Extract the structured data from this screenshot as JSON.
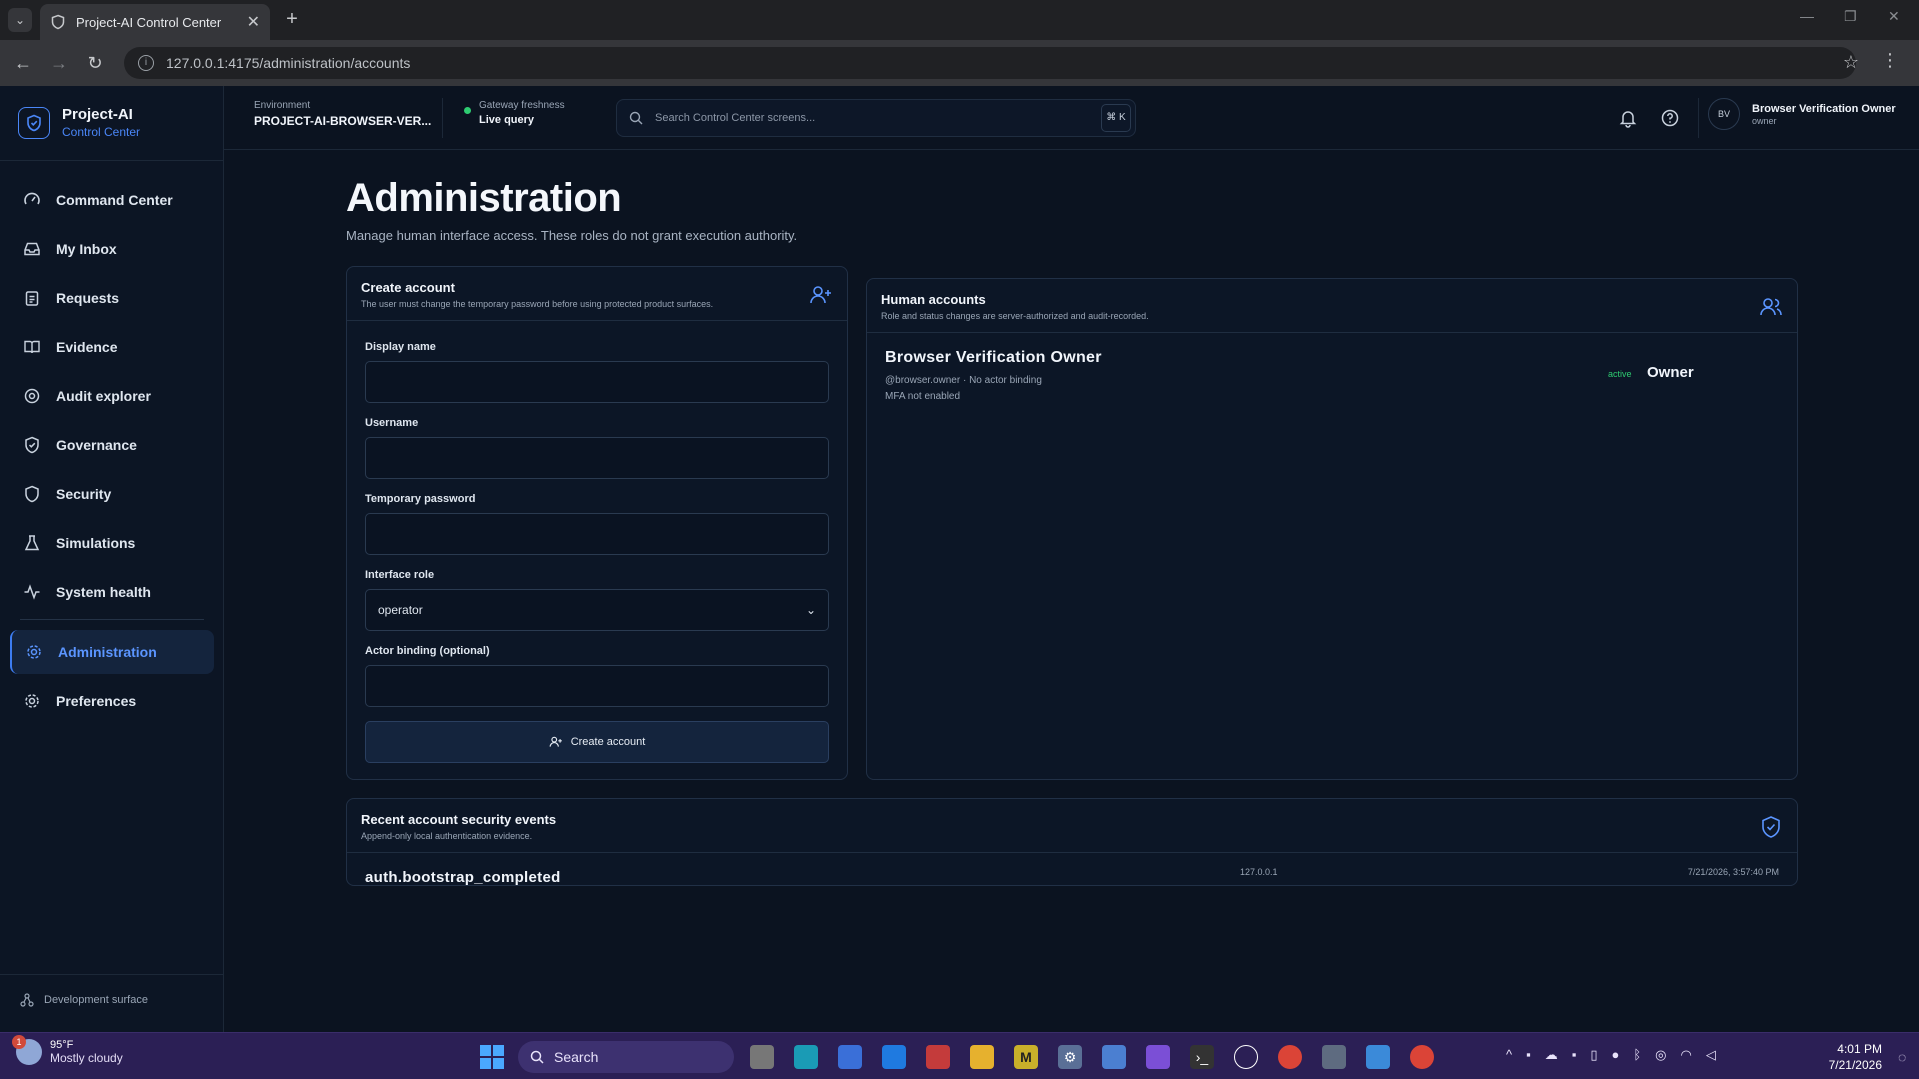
{
  "browser": {
    "tab_title": "Project-AI Control Center",
    "url": "127.0.0.1:4175/administration/accounts"
  },
  "brand": {
    "name": "Project-AI",
    "subtitle": "Control Center"
  },
  "sidebar": {
    "items": [
      {
        "label": "Command Center",
        "icon": "gauge-icon"
      },
      {
        "label": "My Inbox",
        "icon": "inbox-icon"
      },
      {
        "label": "Requests",
        "icon": "clipboard-icon"
      },
      {
        "label": "Evidence",
        "icon": "book-icon"
      },
      {
        "label": "Audit explorer",
        "icon": "audit-icon"
      },
      {
        "label": "Governance",
        "icon": "shield-check-icon"
      },
      {
        "label": "Security",
        "icon": "shield-icon"
      },
      {
        "label": "Simulations",
        "icon": "flask-icon"
      },
      {
        "label": "System health",
        "icon": "pulse-icon"
      }
    ],
    "secondary": [
      {
        "label": "Administration",
        "icon": "gear-icon",
        "active": true
      },
      {
        "label": "Preferences",
        "icon": "gear-icon"
      }
    ],
    "footer": "Development surface"
  },
  "topbar": {
    "env_label": "Environment",
    "env_value": "PROJECT-AI-BROWSER-VER...",
    "fresh_label": "Gateway freshness",
    "fresh_value": "Live query",
    "search_placeholder": "Search Control Center screens...",
    "search_kbd": "⌘ K",
    "user_initials": "BV",
    "user_name": "Browser Verification Owner",
    "user_role": "owner"
  },
  "page": {
    "title": "Administration",
    "subtitle": "Manage human interface access. These roles do not grant execution authority."
  },
  "create_account": {
    "title": "Create account",
    "desc": "The user must change the temporary password before using protected product surfaces.",
    "display_name_label": "Display name",
    "username_label": "Username",
    "temp_password_label": "Temporary password",
    "role_label": "Interface role",
    "role_value": "operator",
    "actor_label": "Actor binding (optional)",
    "button": "Create account"
  },
  "accounts": {
    "title": "Human accounts",
    "desc": "Role and status changes are server-authorized and audit-recorded.",
    "list": [
      {
        "name": "Browser Verification Owner",
        "meta": "@browser.owner · No actor binding",
        "mfa": "MFA not enabled",
        "status": "active",
        "role": "Owner"
      }
    ]
  },
  "events": {
    "title": "Recent account security events",
    "desc": "Append-only local authentication evidence.",
    "list": [
      {
        "name": "auth.bootstrap_completed",
        "ip": "127.0.0.1",
        "time": "7/21/2026, 3:57:40 PM"
      }
    ]
  },
  "taskbar": {
    "temp": "95°F",
    "condition": "Mostly cloudy",
    "weather_badge": "1",
    "search": "Search",
    "time": "4:01 PM",
    "date": "7/21/2026"
  }
}
